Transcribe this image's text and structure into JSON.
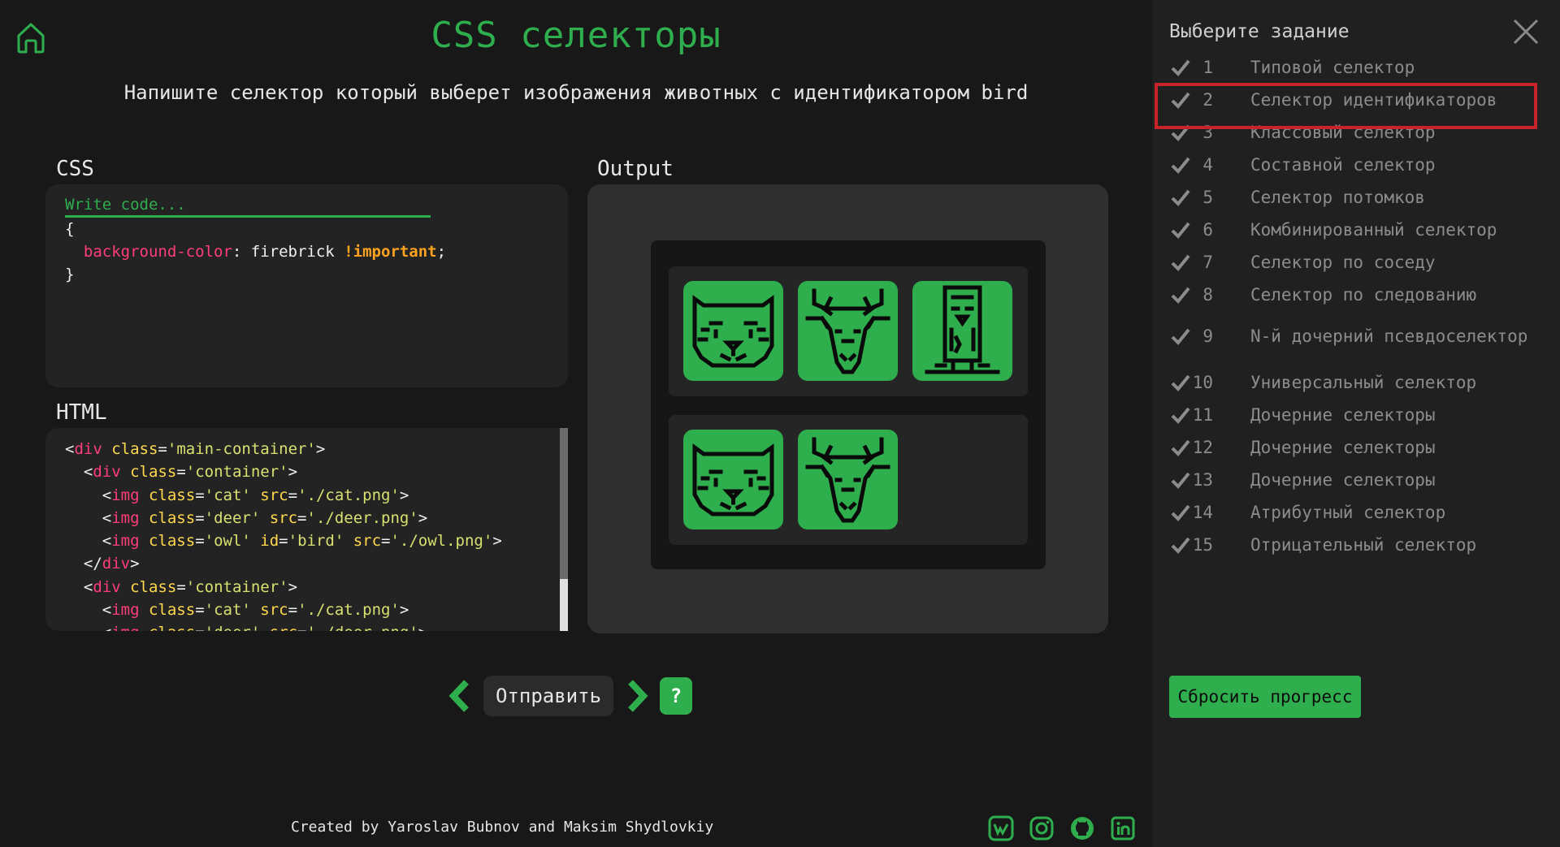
{
  "header": {
    "title": "CSS селекторы",
    "task": "Напишите селектор который выберет изображения животных с идентификатором bird"
  },
  "css_editor": {
    "label": "CSS",
    "placeholder": "Write code...",
    "lines": [
      "{",
      "background-color",
      ": firebrick ",
      "!important",
      ";",
      "}"
    ]
  },
  "html_viewer": {
    "label": "HTML",
    "lines": [
      {
        "indent": "",
        "open": "<",
        "tag": "div",
        "attr": " class",
        "eq": "=",
        "val": "'main-container'",
        "close": ">"
      },
      {
        "indent": "  ",
        "open": "<",
        "tag": "div",
        "attr": " class",
        "eq": "=",
        "val": "'container'",
        "close": ">"
      },
      {
        "indent": "    ",
        "open": "<",
        "tag": "img",
        "attr": " class",
        "eq": "=",
        "val": "'cat'",
        "extra": " src",
        "eq2": "=",
        "val2": "'./cat.png'",
        "close": ">"
      },
      {
        "indent": "    ",
        "open": "<",
        "tag": "img",
        "attr": " class",
        "eq": "=",
        "val": "'deer'",
        "extra": " src",
        "eq2": "=",
        "val2": "'./deer.png'",
        "close": ">"
      },
      {
        "indent": "    ",
        "open": "<",
        "tag": "img",
        "attr": " class",
        "eq": "=",
        "val": "'owl'",
        "extra": " id",
        "eq2": "=",
        "val2": "'bird'",
        "extra2": " src",
        "eq3": "=",
        "val3": "'./owl.png'",
        "close": ">"
      },
      {
        "indent": "  ",
        "open": "</",
        "tag": "div",
        "close": ">"
      },
      {
        "indent": "  ",
        "open": "<",
        "tag": "div",
        "attr": " class",
        "eq": "=",
        "val": "'container'",
        "close": ">"
      },
      {
        "indent": "    ",
        "open": "<",
        "tag": "img",
        "attr": " class",
        "eq": "=",
        "val": "'cat'",
        "extra": " src",
        "eq2": "=",
        "val2": "'./cat.png'",
        "close": ">"
      },
      {
        "indent": "    ",
        "open": "<",
        "tag": "img",
        "attr": " class",
        "eq": "=",
        "val": "'deer'",
        "extra": " src",
        "eq2": "=",
        "val2": "'./deer.png'",
        "close": ">"
      }
    ]
  },
  "output": {
    "label": "Output",
    "containers": [
      {
        "animals": [
          "cat",
          "deer",
          "owl"
        ]
      },
      {
        "animals": [
          "cat",
          "deer"
        ]
      }
    ]
  },
  "controls": {
    "submit_label": "Отправить",
    "help_label": "?",
    "prev_icon": "chevron-left-icon",
    "next_icon": "chevron-right-icon"
  },
  "footer": {
    "credits": "Created by Yaroslav Bubnov and Maksim Shydlovkiy",
    "social_icons": [
      "vk-icon",
      "instagram-icon",
      "github-icon",
      "linkedin-icon"
    ]
  },
  "sidebar": {
    "title": "Выберите задание",
    "active_level": 2,
    "levels": [
      {
        "num": "1",
        "name": "Типовой селектор",
        "done": true
      },
      {
        "num": "2",
        "name": "Селектор идентификаторов",
        "done": true
      },
      {
        "num": "3",
        "name": "Классовый селектор",
        "done": true
      },
      {
        "num": "4",
        "name": "Составной селектор",
        "done": true
      },
      {
        "num": "5",
        "name": "Селектор потомков",
        "done": true
      },
      {
        "num": "6",
        "name": "Комбинированный селектор",
        "done": true
      },
      {
        "num": "7",
        "name": "Селектор по соседу",
        "done": true
      },
      {
        "num": "8",
        "name": "Селектор по следованию",
        "done": true
      },
      {
        "num": "9",
        "name": "N-й дочерний псевдоселектор",
        "done": true
      },
      {
        "num": "10",
        "name": "Универсальный селектор",
        "done": true
      },
      {
        "num": "11",
        "name": "Дочерние селекторы",
        "done": true
      },
      {
        "num": "12",
        "name": "Дочерние селекторы",
        "done": true
      },
      {
        "num": "13",
        "name": "Дочерние селекторы",
        "done": true
      },
      {
        "num": "14",
        "name": "Атрибутный селектор",
        "done": true
      },
      {
        "num": "15",
        "name": "Отрицательный селектор",
        "done": true
      }
    ],
    "reset_label": "Сбросить прогресс"
  },
  "colors": {
    "accent": "#2fae4e",
    "background": "#181818",
    "sidebar_bg": "#202020",
    "active_border": "#c8222a",
    "property": "#ff3d78",
    "important": "#ffa21f"
  }
}
